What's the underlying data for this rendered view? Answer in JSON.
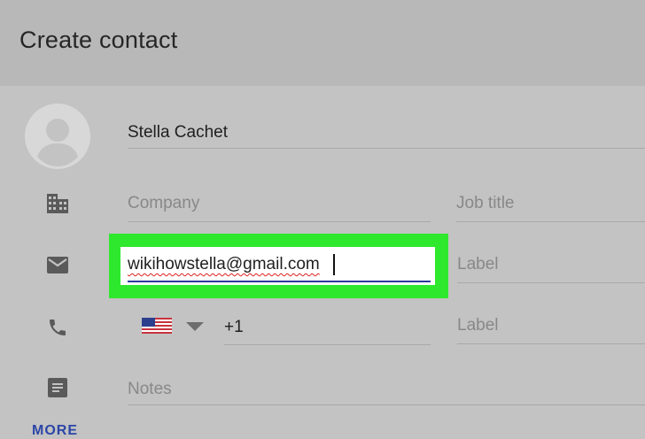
{
  "header": {
    "title": "Create contact"
  },
  "name_field": {
    "value": "Stella Cachet"
  },
  "company_field": {
    "placeholder": "Company"
  },
  "job_title_field": {
    "placeholder": "Job title"
  },
  "email_field": {
    "value": "wikihowstella@gmail.com"
  },
  "email_label_field": {
    "placeholder": "Label"
  },
  "phone_field": {
    "country": "US flag",
    "value": "+1"
  },
  "phone_label_field": {
    "placeholder": "Label"
  },
  "notes_field": {
    "placeholder": "Notes"
  },
  "more_link": {
    "label": "MORE"
  },
  "colors": {
    "highlight": "#2ee82e",
    "accent": "#2a3a9c",
    "link": "#2c46a6"
  },
  "icons": [
    "avatar-icon",
    "building-icon",
    "email-icon",
    "phone-icon",
    "notes-icon",
    "chevron-down-icon"
  ]
}
